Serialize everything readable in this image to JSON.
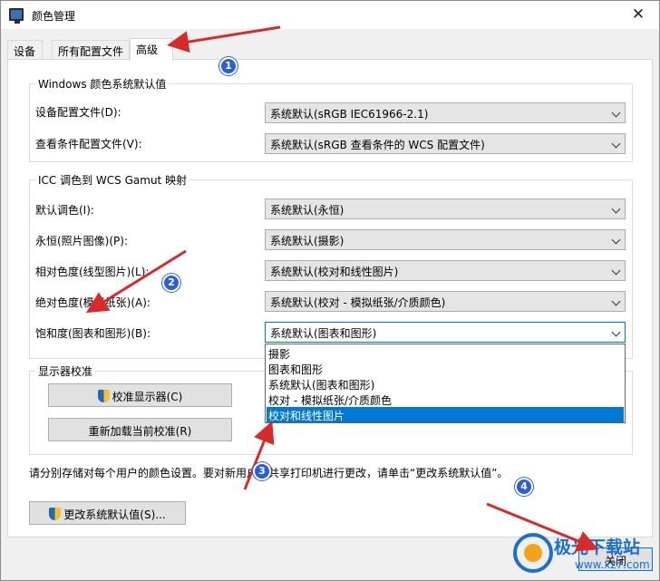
{
  "window": {
    "title": "颜色管理",
    "close_glyph": "✕"
  },
  "tabs": [
    {
      "label": "设备"
    },
    {
      "label": "所有配置文件"
    },
    {
      "label": "高级"
    }
  ],
  "windows_defaults": {
    "group_title": "Windows 颜色系统默认值",
    "device_profile": {
      "label": "设备配置文件(D):",
      "value": "系统默认(sRGB IEC61966-2.1)"
    },
    "viewing_profile": {
      "label": "查看条件配置文件(V):",
      "value": "系统默认(sRGB 查看条件的 WCS 配置文件)"
    }
  },
  "icc_mapping": {
    "group_title": "ICC 调色到 WCS Gamut 映射",
    "rows": [
      {
        "label": "默认调色(I):",
        "value": "系统默认(永恒)"
      },
      {
        "label": "永恒(照片图像)(P):",
        "value": "系统默认(摄影)"
      },
      {
        "label": "相对色度(线型图片)(L):",
        "value": "系统默认(校对和线性图片)"
      },
      {
        "label": "绝对色度(模拟纸张)(A):",
        "value": "系统默认(校对 - 模拟纸张/介质颜色)"
      },
      {
        "label": "饱和度(图表和图形)(B):",
        "value": "系统默认(图表和图形)"
      }
    ],
    "dropdown_options": [
      "摄影",
      "图表和图形",
      "系统默认(图表和图形)",
      "校对 - 模拟纸张/介质颜色",
      "校对和线性图片"
    ],
    "selected_option_index": 4
  },
  "display_calibration": {
    "group_title": "显示器校准",
    "calibrate_button": "校准显示器(C)",
    "reload_button": "重新加载当前校准(R)"
  },
  "note": "请分别存储对每个用户的颜色设置。要对新用户和共享打印机进行更改，请单击“更改系统默认值”。",
  "change_defaults_button": "更改系统默认值(S)...",
  "close_button": "关闭",
  "annotations": [
    "1",
    "2",
    "3",
    "4"
  ],
  "watermark": {
    "text": "极光下载站",
    "url": "www.xz7.com"
  },
  "colors": {
    "selection": "#0078d7",
    "annotation_arrow": "#d92a2a",
    "badge": "#2c5fd6"
  }
}
